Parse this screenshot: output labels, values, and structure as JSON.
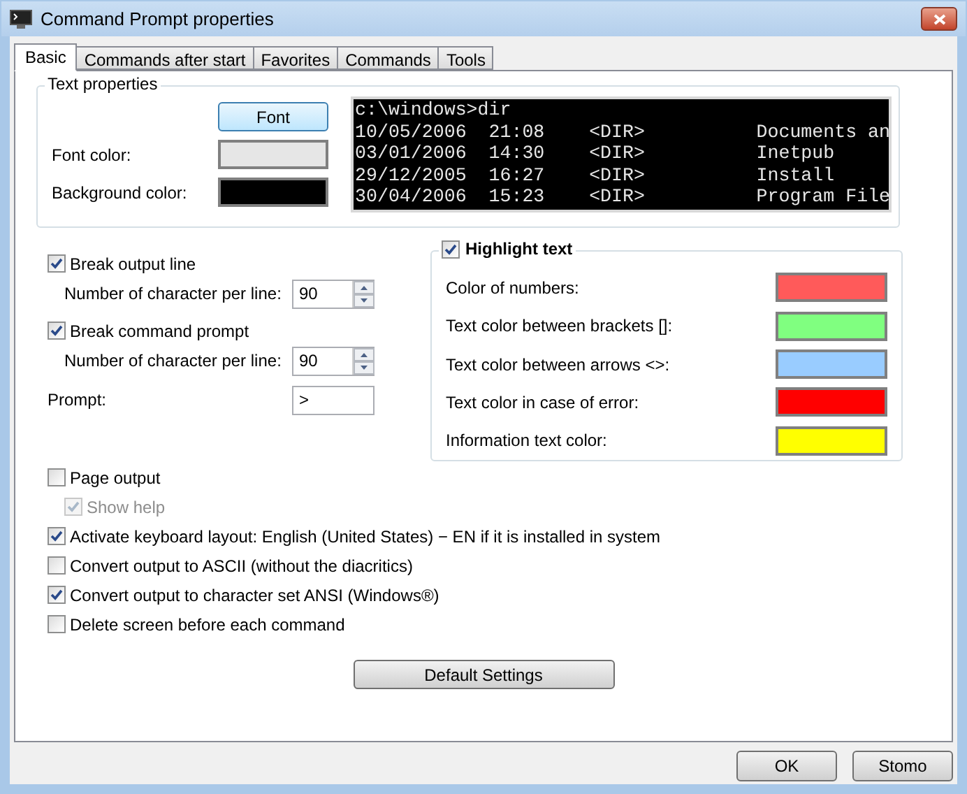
{
  "window": {
    "title": "Command Prompt properties"
  },
  "tabs": [
    {
      "label": "Basic",
      "selected": true
    },
    {
      "label": "Commands after start",
      "selected": false
    },
    {
      "label": "Favorites",
      "selected": false
    },
    {
      "label": "Commands",
      "selected": false
    },
    {
      "label": "Tools",
      "selected": false
    }
  ],
  "text_properties": {
    "title": "Text properties",
    "font_button": "Font",
    "colors": [
      {
        "label": "Font color:",
        "color": "#e6e6e6"
      },
      {
        "label": "Background color:",
        "color": "#000000"
      }
    ],
    "preview_lines": [
      "c:\\windows>dir",
      "10/05/2006  21:08    <DIR>          Documents an",
      "03/01/2006  14:30    <DIR>          Inetpub",
      "29/12/2005  16:27    <DIR>          Install",
      "30/04/2006  15:23    <DIR>          Program File"
    ]
  },
  "line_options": [
    {
      "kind": "checkbox",
      "label": "Break output line",
      "checked": true
    },
    {
      "kind": "spinner",
      "label": "Number of character per line:",
      "value": "90"
    },
    {
      "kind": "checkbox",
      "label": "Break command prompt",
      "checked": true
    },
    {
      "kind": "spinner",
      "label": "Number of character per line:",
      "value": "90"
    },
    {
      "kind": "text",
      "label": "Prompt:",
      "value": ">"
    }
  ],
  "highlight": {
    "label": "Highlight text",
    "checked": true,
    "items": [
      {
        "label": "Color of numbers:",
        "color": "#ff5a5a"
      },
      {
        "label": "Text color between brackets []:",
        "color": "#80ff80"
      },
      {
        "label": "Text color between arrows <>:",
        "color": "#99ccff"
      },
      {
        "label": "Text color in case of error:",
        "color": "#ff0000"
      },
      {
        "label": "Information text color:",
        "color": "#ffff00"
      }
    ]
  },
  "options": [
    {
      "label": "Page output",
      "checked": false,
      "disabled": false,
      "children": [
        {
          "label": "Show help",
          "checked": true,
          "disabled": true
        }
      ]
    },
    {
      "label": "Activate keyboard layout: English (United States) − EN if it is installed in system",
      "checked": true,
      "disabled": false
    },
    {
      "label": "Convert output to ASCII (without the diacritics)",
      "checked": false,
      "disabled": false
    },
    {
      "label": "Convert output to character set ANSI (Windows®)",
      "checked": true,
      "disabled": false
    },
    {
      "label": "Delete screen before each command",
      "checked": false,
      "disabled": false
    }
  ],
  "default_button": "Default Settings",
  "buttons": [
    "OK",
    "Stomo"
  ]
}
